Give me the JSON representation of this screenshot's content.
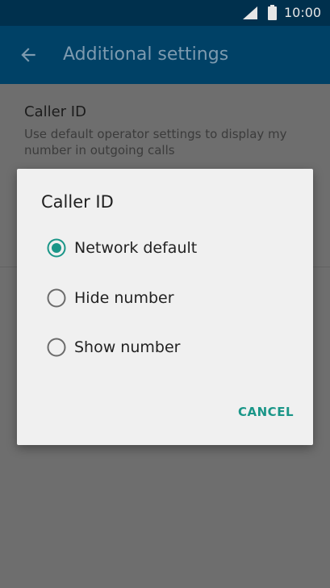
{
  "status_bar": {
    "time": "10:00",
    "icons": [
      "signal-icon",
      "battery-icon"
    ]
  },
  "app_bar": {
    "back_icon": "arrow-back-icon",
    "title": "Additional settings"
  },
  "background_item": {
    "title": "Caller ID",
    "subtitle": "Use default operator settings to display my number in outgoing calls"
  },
  "dialog": {
    "title": "Caller ID",
    "options": [
      {
        "label": "Network default",
        "selected": true
      },
      {
        "label": "Hide number",
        "selected": false
      },
      {
        "label": "Show number",
        "selected": false
      }
    ],
    "cancel_label": "CANCEL"
  },
  "colors": {
    "status_bar": "#00304d",
    "app_bar": "#004166",
    "accent": "#1a9688",
    "scrim_background": "#6e6e6e",
    "dialog_background": "#f0f0f0"
  }
}
